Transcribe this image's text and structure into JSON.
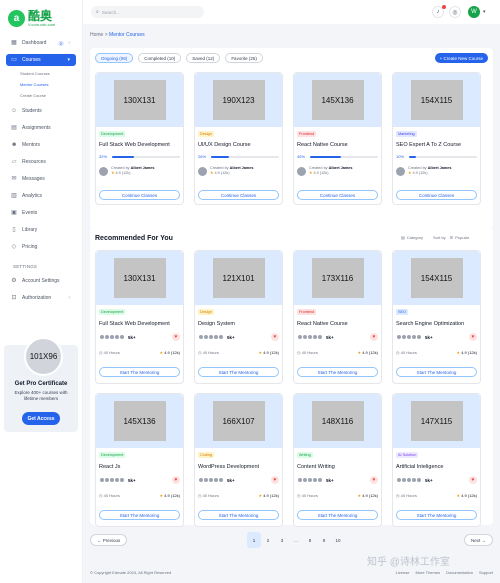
{
  "brand": {
    "logo_letter": "a",
    "name": "酷奥",
    "subtitle": "V.com.cdn.com",
    "accent": "#2563eb",
    "brand_green": "#16a34a"
  },
  "sidebar": {
    "items": [
      {
        "label": "Dashboard",
        "icon": "grid-icon",
        "badge": "2"
      },
      {
        "label": "Courses",
        "icon": "book-icon",
        "active": true
      },
      {
        "label": "Students",
        "icon": "users-icon"
      },
      {
        "label": "Assignments",
        "icon": "clipboard-icon"
      },
      {
        "label": "Mentors",
        "icon": "user-check-icon"
      },
      {
        "label": "Resources",
        "icon": "folder-icon"
      },
      {
        "label": "Messages",
        "icon": "message-icon"
      },
      {
        "label": "Analytics",
        "icon": "chart-icon"
      },
      {
        "label": "Events",
        "icon": "calendar-icon"
      },
      {
        "label": "Library",
        "icon": "library-icon"
      },
      {
        "label": "Pricing",
        "icon": "tag-icon"
      }
    ],
    "subitems": [
      "Student Courses",
      "Mentor Courses",
      "Create Course"
    ],
    "settings_label": "SETTINGS",
    "settings_items": [
      {
        "label": "Account Settings",
        "icon": "settings-icon"
      },
      {
        "label": "Authorization",
        "icon": "lock-icon"
      }
    ],
    "promo": {
      "image": "101X96",
      "title": "Get Pro Certificate",
      "text": "Explore 400+ courses with lifetime members",
      "button": "Get Access"
    }
  },
  "topbar": {
    "search_placeholder": "Search...",
    "avatar_letter": "W"
  },
  "breadcrumb": {
    "home": "Home",
    "sep": ">",
    "current": "Mentor Courses"
  },
  "tabs": [
    "Ongoing (08)",
    "Completed (10)",
    "Saved (12)",
    "Favorite (25)"
  ],
  "create_button": "+ Create New Course",
  "ongoing": [
    {
      "image": "130X131",
      "tag": "Development",
      "tagc": "dev",
      "title": "Full Stack Web Development",
      "progress": 32,
      "progress_label": "32%",
      "creator": "Albert James",
      "rating": "4.9 (12k)",
      "button": "Continue Classes"
    },
    {
      "image": "190X123",
      "tag": "Design",
      "tagc": "des",
      "title": "UI/UX Design Course",
      "progress": 26,
      "progress_label": "26%",
      "creator": "Albert James",
      "rating": "4.9 (12k)",
      "button": "Continue Classes"
    },
    {
      "image": "145X136",
      "tag": "Frontend",
      "tagc": "fe",
      "title": "React Native Course",
      "progress": 45,
      "progress_label": "45%",
      "creator": "Albert James",
      "rating": "4.9 (12k)",
      "button": "Continue Classes"
    },
    {
      "image": "154X115",
      "tag": "Marketing",
      "tagc": "mk",
      "title": "SEO Expert A To Z Course",
      "progress": 10,
      "progress_label": "10%",
      "creator": "Albert James",
      "rating": "4.9 (12k)",
      "button": "Continue Classes"
    }
  ],
  "created_by": "Created by",
  "recommended": {
    "title": "Recommended For You",
    "category_label": "Category",
    "sort_label": "Sort by",
    "sort_value": "Popular",
    "cards": [
      {
        "image": "130X131",
        "tag": "Development",
        "tagc": "dev",
        "title": "Full Stack Web Development",
        "students": "5k+",
        "hours": "40 Hours",
        "rating": "4.9 (12k)",
        "button": "Start The Mentoring"
      },
      {
        "image": "121X101",
        "tag": "Design",
        "tagc": "des",
        "title": "Design System",
        "students": "5k+",
        "hours": "40 Hours",
        "rating": "4.9 (12k)",
        "button": "Start The Mentoring"
      },
      {
        "image": "173X116",
        "tag": "Frontend",
        "tagc": "fe",
        "title": "React Native Course",
        "students": "5k+",
        "hours": "40 Hours",
        "rating": "4.9 (12k)",
        "button": "Start The Mentoring"
      },
      {
        "image": "154X115",
        "tag": "SEO",
        "tagc": "seo",
        "title": "Search Engine Optimization",
        "students": "5k+",
        "hours": "40 Hours",
        "rating": "4.9 (12k)",
        "button": "Start The Mentoring"
      },
      {
        "image": "145X136",
        "tag": "Development",
        "tagc": "dev",
        "title": "React Js",
        "students": "5k+",
        "hours": "40 Hours",
        "rating": "4.9 (12k)",
        "button": "Start The Mentoring"
      },
      {
        "image": "166X107",
        "tag": "Coding",
        "tagc": "cod",
        "title": "WordPress Development",
        "students": "5k+",
        "hours": "40 Hours",
        "rating": "4.9 (12k)",
        "button": "Start The Mentoring"
      },
      {
        "image": "148X116",
        "tag": "Writing",
        "tagc": "wr",
        "title": "Content Writing",
        "students": "5k+",
        "hours": "40 Hours",
        "rating": "4.9 (12k)",
        "button": "Start The Mentoring"
      },
      {
        "image": "147X115",
        "tag": "AI Solution",
        "tagc": "ai",
        "title": "Artificial Inteligence",
        "students": "5k+",
        "hours": "40 Hours",
        "rating": "4.9 (12k)",
        "button": "Start The Mentoring"
      }
    ]
  },
  "pagination": {
    "prev": "← Previous",
    "next": "Next →",
    "pages": [
      "1",
      "2",
      "3",
      "...",
      "8",
      "9",
      "10"
    ],
    "active": "1"
  },
  "footer": {
    "copyright": "© Copyright Edmate 2024, All Right Reserved",
    "links": [
      "License",
      "More Themes",
      "Documentation",
      "Support"
    ]
  },
  "watermark": "知乎 @诗林工作室"
}
